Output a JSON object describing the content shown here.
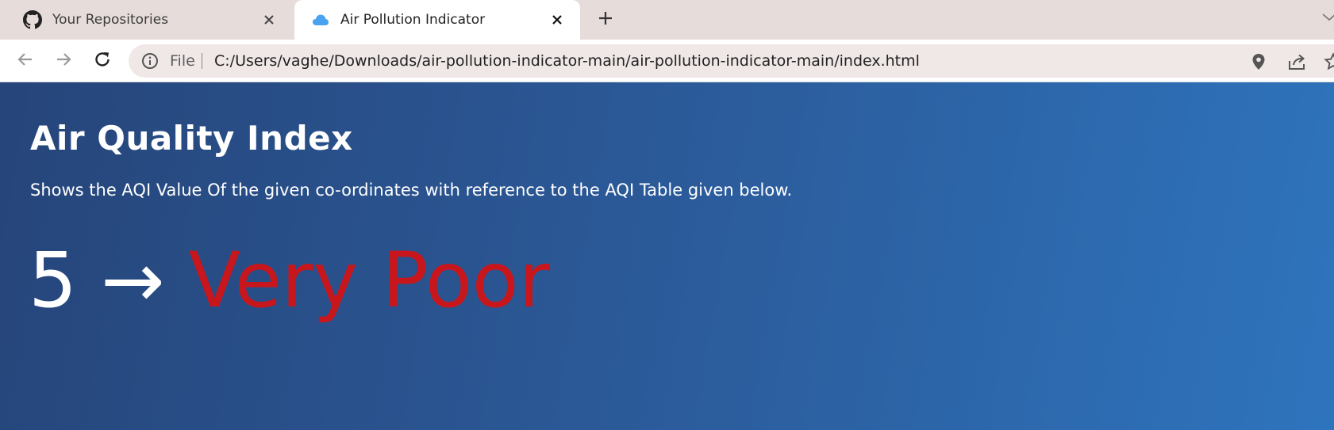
{
  "browser": {
    "tabs": [
      {
        "title": "Your Repositories",
        "favicon": "github-icon",
        "active": false
      },
      {
        "title": "Air Pollution Indicator",
        "favicon": "cloud-icon",
        "active": true
      }
    ],
    "address_bar": {
      "scheme_label": "File",
      "url": "C:/Users/vaghe/Downloads/air-pollution-indicator-main/air-pollution-indicator-main/index.html"
    }
  },
  "page": {
    "title": "Air Quality Index",
    "description": "Shows the AQI Value Of the given co-ordinates with reference to the AQI Table given below.",
    "aqi_value": "5",
    "arrow": "→",
    "aqi_status": "Very Poor"
  },
  "colors": {
    "tab_strip": "#e6dcda",
    "page_gradient_start": "#26457a",
    "page_gradient_end": "#2e74bd",
    "status_color": "#c8161d"
  }
}
